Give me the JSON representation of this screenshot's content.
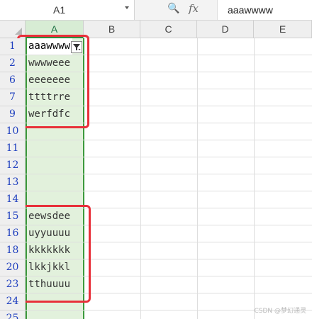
{
  "formula_bar": {
    "name_box": "A1",
    "formula_value": "aaawwww",
    "zoom_icon_glyph": "🔍",
    "fx_label": "fx"
  },
  "columns": [
    "A",
    "B",
    "C",
    "D",
    "E"
  ],
  "rows": [
    {
      "num": "1",
      "value": "aaawwww",
      "active": true,
      "has_filter": true
    },
    {
      "num": "2",
      "value": "wwwweee"
    },
    {
      "num": "6",
      "value": "eeeeeee"
    },
    {
      "num": "7",
      "value": "ttttrre"
    },
    {
      "num": "9",
      "value": "werfdfc"
    },
    {
      "num": "10",
      "value": ""
    },
    {
      "num": "11",
      "value": ""
    },
    {
      "num": "12",
      "value": ""
    },
    {
      "num": "13",
      "value": ""
    },
    {
      "num": "14",
      "value": ""
    },
    {
      "num": "15",
      "value": "eewsdee"
    },
    {
      "num": "16",
      "value": "uyyuuuu"
    },
    {
      "num": "18",
      "value": "kkkkkkk"
    },
    {
      "num": "20",
      "value": "lkkjkkl"
    },
    {
      "num": "23",
      "value": "tthuuuu"
    },
    {
      "num": "24",
      "value": ""
    },
    {
      "num": "25",
      "value": ""
    }
  ],
  "icons": {
    "filter": "filter-icon",
    "zoom": "zoom-icon",
    "fx": "fx-icon"
  },
  "colors": {
    "selected_column": "#e2f1dc",
    "column_border": "#3c9a3c",
    "row_number": "#1f3fbf",
    "highlight": "#e8303a"
  },
  "watermark": "CSDN @梦幻通灵"
}
